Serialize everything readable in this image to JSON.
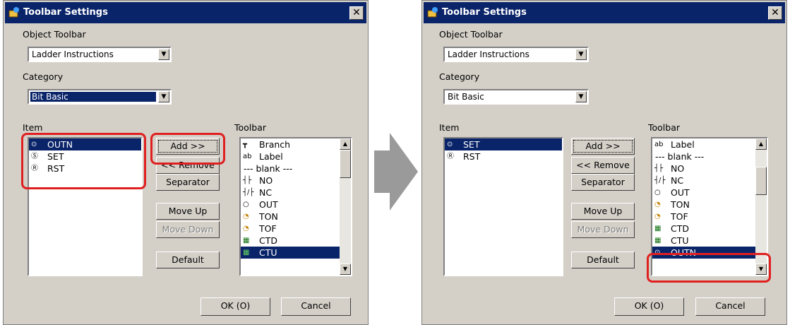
{
  "dialogs": [
    {
      "title": "Toolbar Settings",
      "close": "✕",
      "object_toolbar_label": "Object Toolbar",
      "object_toolbar_value": "Ladder Instructions",
      "category_label": "Category",
      "category_value": "Bit Basic",
      "item_label": "Item",
      "toolbar_label": "Toolbar",
      "items": [
        {
          "icon": "⊙",
          "label": "OUTN"
        },
        {
          "icon": "Ⓢ",
          "label": "SET"
        },
        {
          "icon": "Ⓡ",
          "label": "RST"
        }
      ],
      "toolbar_items": [
        {
          "icon": "┳",
          "label": "Branch"
        },
        {
          "icon": "ab",
          "label": "Label"
        },
        {
          "icon": "",
          "label": "--- blank ---"
        },
        {
          "icon": "┤├",
          "label": "NO"
        },
        {
          "icon": "┤/├",
          "label": "NC"
        },
        {
          "icon": "○",
          "label": "OUT"
        },
        {
          "icon": "◔",
          "label": "TON"
        },
        {
          "icon": "◔",
          "label": "TOF"
        },
        {
          "icon": "▦",
          "label": "CTD"
        },
        {
          "icon": "▦",
          "label": "CTU"
        }
      ],
      "buttons": {
        "add": "Add >>",
        "remove": "<< Remove",
        "separator": "Separator",
        "move_up": "Move Up",
        "move_down": "Move Down",
        "default": "Default",
        "ok": "OK (O)",
        "cancel": "Cancel"
      }
    },
    {
      "title": "Toolbar Settings",
      "close": "✕",
      "object_toolbar_label": "Object Toolbar",
      "object_toolbar_value": "Ladder Instructions",
      "category_label": "Category",
      "category_value": "Bit Basic",
      "item_label": "Item",
      "toolbar_label": "Toolbar",
      "items": [
        {
          "icon": "⊙",
          "label": "SET"
        },
        {
          "icon": "Ⓡ",
          "label": "RST"
        }
      ],
      "toolbar_items": [
        {
          "icon": "ab",
          "label": "Label"
        },
        {
          "icon": "",
          "label": "--- blank ---"
        },
        {
          "icon": "┤├",
          "label": "NO"
        },
        {
          "icon": "┤/├",
          "label": "NC"
        },
        {
          "icon": "○",
          "label": "OUT"
        },
        {
          "icon": "◔",
          "label": "TON"
        },
        {
          "icon": "◔",
          "label": "TOF"
        },
        {
          "icon": "▦",
          "label": "CTD"
        },
        {
          "icon": "▦",
          "label": "CTU"
        },
        {
          "icon": "⊙",
          "label": "OUTN"
        }
      ],
      "buttons": {
        "add": "Add >>",
        "remove": "<< Remove",
        "separator": "Separator",
        "move_up": "Move Up",
        "move_down": "Move Down",
        "default": "Default",
        "ok": "OK (O)",
        "cancel": "Cancel"
      }
    }
  ],
  "colors": {
    "dialog_bg": "#d4d0c8",
    "title_bg": "#0a246a",
    "selection": "#0a246a",
    "highlight": "#e02020",
    "arrow": "#9a9a9a"
  }
}
